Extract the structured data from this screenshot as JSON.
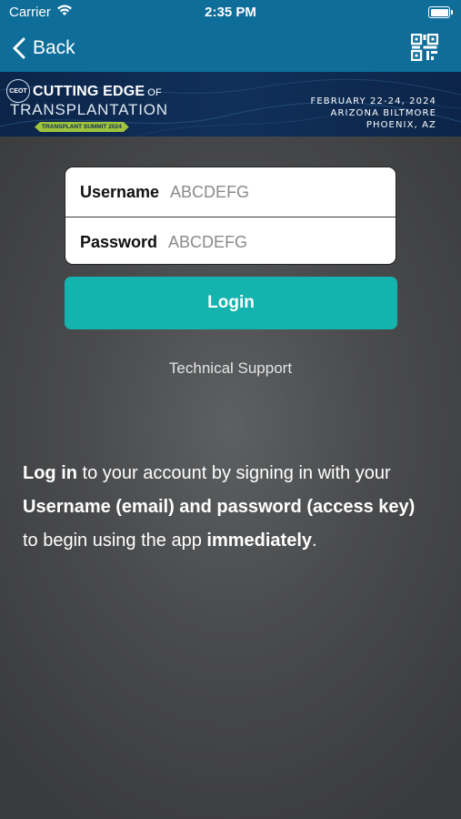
{
  "status_bar": {
    "carrier": "Carrier",
    "time": "2:35 PM"
  },
  "nav": {
    "back_label": "Back",
    "icons": {
      "back": "chevron-left-icon",
      "scan": "qr-scan-icon"
    },
    "bar_color": "#0f6d9a"
  },
  "banner": {
    "badge": "CEOT",
    "title_line1": "CUTTING EDGE",
    "title_line1_suffix": "OF",
    "title_line2": "TRANSPLANTATION",
    "subtitle": "TRANSPLANT SUMMIT 2024",
    "dates": "FEBRUARY 22-24, 2024",
    "venue": "ARIZONA BILTMORE",
    "city": "PHOENIX, AZ"
  },
  "form": {
    "username_label": "Username",
    "username_placeholder": "ABCDEFG",
    "username_value": "",
    "password_label": "Password",
    "password_placeholder": "ABCDEFG",
    "password_value": "",
    "login_label": "Login",
    "login_color": "#14b3ae"
  },
  "support_link": "Technical Support",
  "instructions": {
    "part1_bold": "Log in",
    "part2": " to your account by signing in with your ",
    "part3_bold": "Username (email) and password (access key)",
    "part4": " to begin using the app ",
    "part5_bold": "immediately",
    "part6": "."
  }
}
